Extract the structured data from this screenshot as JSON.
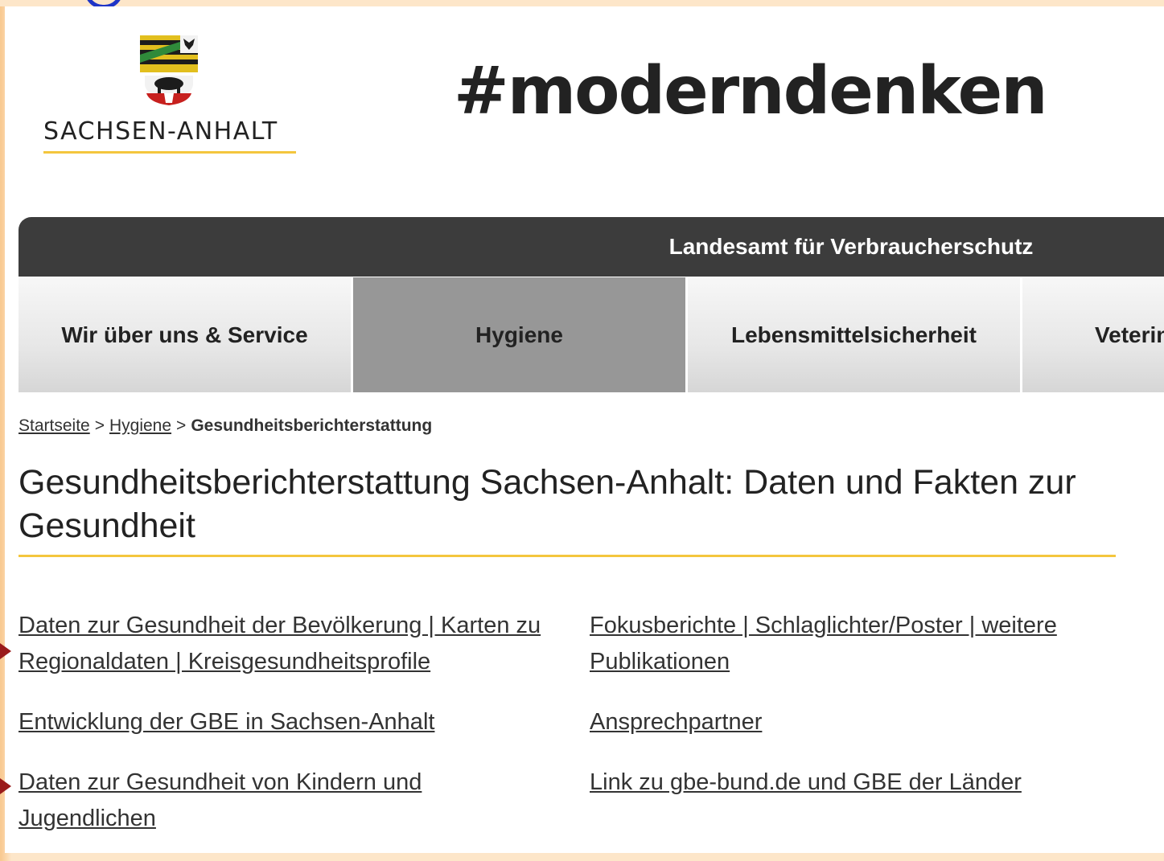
{
  "header": {
    "logo_text": "SACHSEN-ANHALT",
    "hashtag": "#moderndenken"
  },
  "agency": {
    "title": "Landesamt für Verbraucherschutz"
  },
  "nav": {
    "items": [
      {
        "label": "Wir über uns & Service"
      },
      {
        "label": "Hygiene"
      },
      {
        "label": "Lebensmittelsicherheit"
      },
      {
        "label": "Veterin"
      }
    ],
    "active_index": 1
  },
  "breadcrumb": {
    "items": [
      "Startseite",
      "Hygiene"
    ],
    "separator": ">",
    "current": "Gesundheitsberichterstattung"
  },
  "main": {
    "title": "Gesundheitsberichterstattung Sachsen-Anhalt: Daten und Fakten zur Gesundheit",
    "links_left": [
      "Daten zur Gesundheit der Bevölkerung | Karten zu Regionaldaten | Kreisgesundheitsprofile",
      "Entwicklung der GBE in Sachsen-Anhalt",
      "Daten zur Gesundheit von Kindern und Jugendlichen"
    ],
    "links_right": [
      "Fokusberichte | Schlaglichter/Poster | weitere Publikationen",
      "Ansprechpartner",
      "Link zu gbe-bund.de und GBE der Länder"
    ]
  },
  "colors": {
    "accent_yellow": "#f4c63d",
    "agency_bar": "#3c3c3c",
    "nav_active": "#979797",
    "frame": "#fde6c9"
  }
}
